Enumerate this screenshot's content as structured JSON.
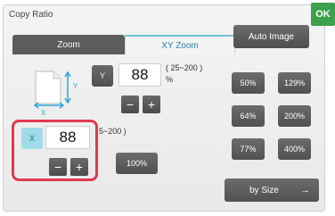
{
  "dialog": {
    "title": "Copy Ratio",
    "ok_label": "OK",
    "auto_image_label": "Auto Image"
  },
  "tabs": {
    "zoom_label": "Zoom",
    "xy_zoom_label": "XY Zoom"
  },
  "y_axis": {
    "label": "Y",
    "value": "88",
    "range": "( 25~200 )",
    "unit": "%",
    "minus": "−",
    "plus": "+"
  },
  "x_axis": {
    "label": "X",
    "value": "88",
    "range": "5~200 )",
    "minus": "−",
    "plus": "+"
  },
  "presets": {
    "p50": "50%",
    "p129": "129%",
    "p64": "64%",
    "p200": "200%",
    "p77": "77%",
    "p400": "400%",
    "p100": "100%"
  },
  "by_size": {
    "label": "by Size",
    "arrow": "→"
  },
  "diagram": {
    "x_letter": "X",
    "y_letter": "Y"
  },
  "colors": {
    "accent_cyan": "#6fc0dc",
    "active_axis": "#9fdbe9",
    "ok_green": "#3ca14c",
    "highlight_red": "#e03a52",
    "button_gray": "#5c5c5c"
  }
}
